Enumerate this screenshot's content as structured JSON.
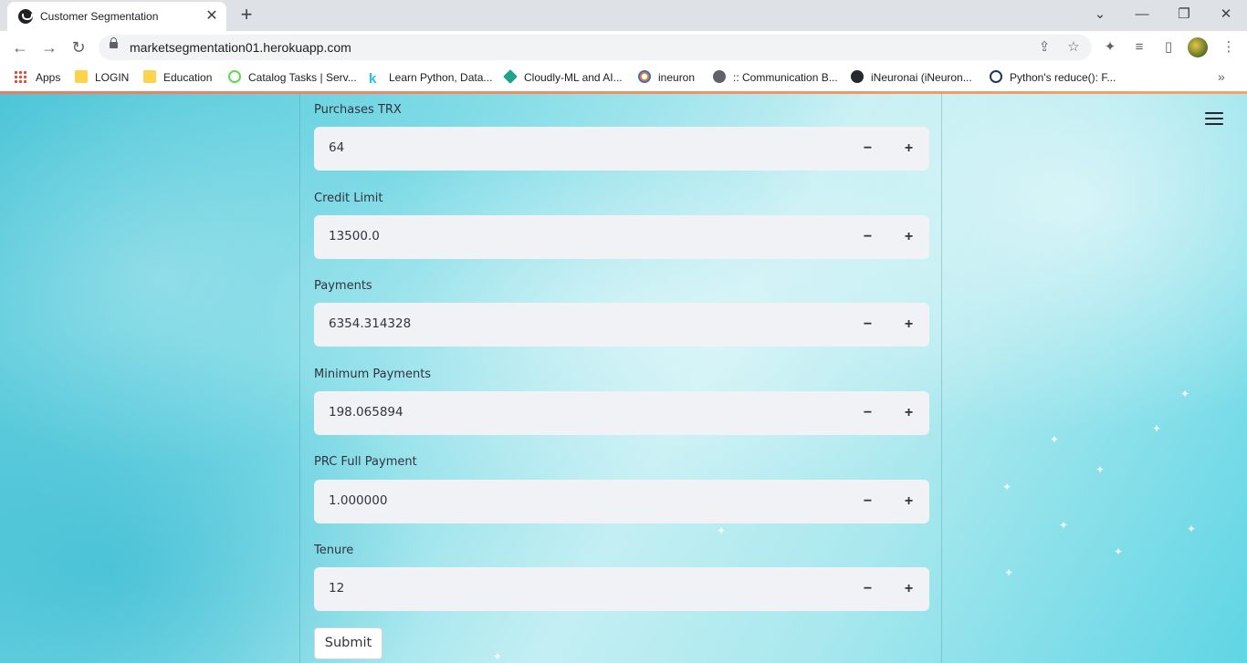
{
  "browser": {
    "tab_title": "Customer Segmentation",
    "tab_close": "✕",
    "new_tab": "+",
    "url": "marketsegmentation01.herokuapp.com",
    "window_controls": [
      "⌄",
      "—",
      "❐",
      "✕"
    ]
  },
  "bookmarks": [
    {
      "label": "Apps",
      "icon": "apps-grid-icon"
    },
    {
      "label": "LOGIN",
      "icon": "folder-icon"
    },
    {
      "label": "Education",
      "icon": "folder-icon"
    },
    {
      "label": "Catalog Tasks | Serv...",
      "icon": "servicenow-icon"
    },
    {
      "label": "Learn Python, Data...",
      "icon": "kaggle-icon"
    },
    {
      "label": "Cloudly-ML and AI...",
      "icon": "cloudly-icon"
    },
    {
      "label": "ineuron",
      "icon": "ineuron-icon"
    },
    {
      "label": ":: Communication B...",
      "icon": "globe-icon"
    },
    {
      "label": "iNeuronai (iNeuron...",
      "icon": "github-icon"
    },
    {
      "label": "Python's reduce(): F...",
      "icon": "python-icon"
    }
  ],
  "form": {
    "fields": [
      {
        "label": "Purchases TRX",
        "value": "64"
      },
      {
        "label": "Credit Limit",
        "value": "13500.0"
      },
      {
        "label": "Payments",
        "value": "6354.314328"
      },
      {
        "label": "Minimum Payments",
        "value": "198.065894"
      },
      {
        "label": "PRC Full Payment",
        "value": "1.000000"
      },
      {
        "label": "Tenure",
        "value": "12"
      }
    ],
    "minus_label": "−",
    "plus_label": "+",
    "submit_label": "Submit"
  }
}
